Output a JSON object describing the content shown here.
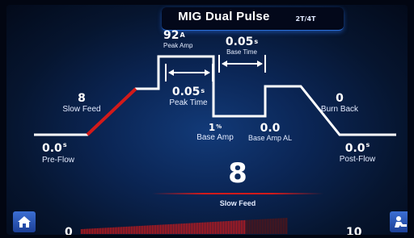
{
  "header": {
    "title": "MIG Dual Pulse",
    "mode": "2T/4T"
  },
  "params": {
    "pre_flow": {
      "value": "0.0",
      "unit": "s",
      "label": "Pre-Flow"
    },
    "slow_feed": {
      "value": "8",
      "label": "Slow Feed"
    },
    "peak_amp": {
      "value": "92",
      "unit": "A",
      "label": "Peak Amp"
    },
    "peak_time": {
      "value": "0.05",
      "unit": "s",
      "label": "Peak Time"
    },
    "base_time": {
      "value": "0.05",
      "unit": "s",
      "label": "Base Time"
    },
    "base_amp": {
      "value": "1",
      "unit": "%",
      "label": "Base Amp"
    },
    "base_amp_al": {
      "value": "0.0",
      "label": "Base Amp AL"
    },
    "burn_back": {
      "value": "0",
      "label": "Burn Back"
    },
    "post_flow": {
      "value": "0.0",
      "unit": "s",
      "label": "Post-Flow"
    }
  },
  "selected": {
    "value": "8",
    "label": "Slow Feed"
  },
  "scale": {
    "min": "0",
    "max": "10",
    "level": 0.8
  },
  "colors": {
    "accent": "#d21a1a",
    "curve": "#ffffff",
    "button": "#2f5fc8"
  },
  "icons": {
    "home": "home-icon",
    "welder": "welder-icon"
  }
}
